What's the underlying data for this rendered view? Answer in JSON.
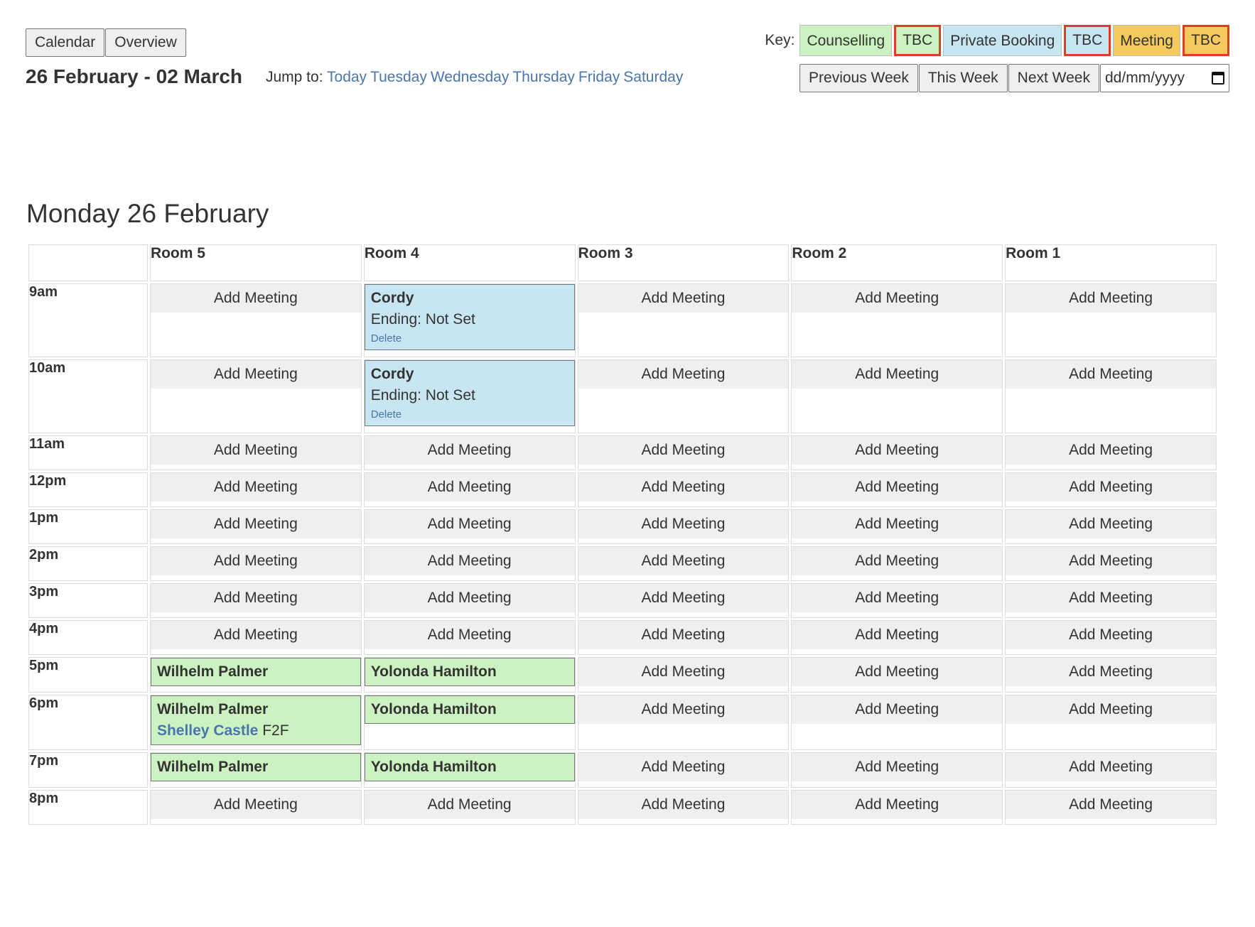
{
  "top_nav": {
    "calendar": "Calendar",
    "overview": "Overview"
  },
  "week_title": "26 February - 02 March",
  "jump": {
    "label": "Jump to:",
    "links": [
      "Today",
      "Tuesday",
      "Wednesday",
      "Thursday",
      "Friday",
      "Saturday"
    ]
  },
  "key": {
    "label": "Key:",
    "items": [
      {
        "label": "Counselling",
        "color": "#cdf2c1",
        "tbc": false
      },
      {
        "label": "TBC",
        "color": "#cdf2c1",
        "tbc": true
      },
      {
        "label": "Private Booking",
        "color": "#c8e6f2",
        "tbc": false
      },
      {
        "label": "TBC",
        "color": "#c8e6f2",
        "tbc": true
      },
      {
        "label": "Meeting",
        "color": "#f4c95d",
        "tbc": false
      },
      {
        "label": "TBC",
        "color": "#f4c95d",
        "tbc": true
      }
    ],
    "tbc_border_color": "#e23b25"
  },
  "week_nav": {
    "previous": "Previous Week",
    "this": "This Week",
    "next": "Next Week",
    "date_placeholder": "dd/mm/yyyy"
  },
  "day": {
    "heading": "Monday 26 February",
    "rooms": [
      "Room 5",
      "Room 4",
      "Room 3",
      "Room 2",
      "Room 1"
    ],
    "add_label": "Add Meeting",
    "rows": [
      {
        "time": "9am",
        "height": 104,
        "cells": [
          null,
          {
            "type": "private",
            "name": "Cordy",
            "ending": "Ending: Not Set",
            "delete": "Delete"
          },
          null,
          null,
          null
        ]
      },
      {
        "time": "10am",
        "height": 104,
        "cells": [
          null,
          {
            "type": "private",
            "name": "Cordy",
            "ending": "Ending: Not Set",
            "delete": "Delete"
          },
          null,
          null,
          null
        ]
      },
      {
        "time": "11am",
        "height": 49,
        "cells": [
          null,
          null,
          null,
          null,
          null
        ]
      },
      {
        "time": "12pm",
        "height": 49,
        "cells": [
          null,
          null,
          null,
          null,
          null
        ]
      },
      {
        "time": "1pm",
        "height": 49,
        "cells": [
          null,
          null,
          null,
          null,
          null
        ]
      },
      {
        "time": "2pm",
        "height": 49,
        "cells": [
          null,
          null,
          null,
          null,
          null
        ]
      },
      {
        "time": "3pm",
        "height": 49,
        "cells": [
          null,
          null,
          null,
          null,
          null
        ]
      },
      {
        "time": "4pm",
        "height": 49,
        "cells": [
          null,
          null,
          null,
          null,
          null
        ]
      },
      {
        "time": "5pm",
        "height": 50,
        "cells": [
          {
            "type": "counselling",
            "name": "Wilhelm Palmer"
          },
          {
            "type": "counselling",
            "name": "Yolonda Hamilton"
          },
          null,
          null,
          null
        ]
      },
      {
        "time": "6pm",
        "height": 78,
        "cells": [
          {
            "type": "counselling",
            "name": "Wilhelm Palmer",
            "sub_link": "Shelley Castle",
            "sub_text": "F2F"
          },
          {
            "type": "counselling",
            "name": "Yolonda Hamilton"
          },
          null,
          null,
          null
        ]
      },
      {
        "time": "7pm",
        "height": 50,
        "cells": [
          {
            "type": "counselling",
            "name": "Wilhelm Palmer"
          },
          {
            "type": "counselling",
            "name": "Yolonda Hamilton"
          },
          null,
          null,
          null
        ]
      },
      {
        "time": "8pm",
        "height": 49,
        "cells": [
          null,
          null,
          null,
          null,
          null
        ]
      }
    ]
  }
}
